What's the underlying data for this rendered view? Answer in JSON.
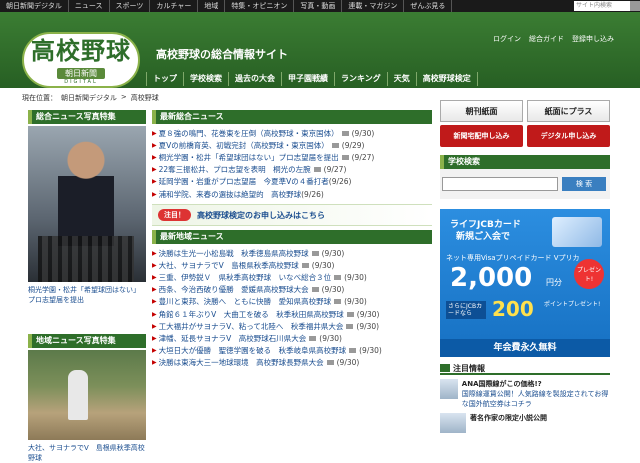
{
  "topbar": {
    "items": [
      "朝日新聞デジタル",
      "ニュース",
      "スポーツ",
      "カルチャー",
      "地域",
      "特集・オピニオン",
      "写真・動画",
      "連載・マガジン",
      "ぜんぶ見る"
    ],
    "search_placeholder": "サイト内検索"
  },
  "header": {
    "logo_main": "高校野球",
    "logo_sub": "朝日新聞",
    "logo_digital": "DIGITAL",
    "tagline": "高校野球の総合情報サイト",
    "util_links": [
      "ログイン",
      "総合ガイド",
      "登録申し込み"
    ],
    "nav": [
      "トップ",
      "学校検索",
      "過去の大会",
      "甲子園戦績",
      "ランキング",
      "天気",
      "高校野球検定"
    ]
  },
  "breadcrumb": [
    "現在位置：",
    "朝日新聞デジタル",
    ">",
    "高校野球"
  ],
  "left": {
    "photo_news_title": "総合ニュース写真特集",
    "photo_news_caption": "桐光学園・松井「希望球団はない」プロ志望届を提出",
    "local_news_title": "地域ニュース写真特集",
    "local_news_caption": "大社、サヨナラでV　島根県秋季高校野球"
  },
  "middle": {
    "general_title": "最新総合ニュース",
    "general_items": [
      {
        "t": "夏８強の鳴門、花巻東を圧倒（高校野球・東京国体）",
        "d": "(9/30)",
        "photo": true
      },
      {
        "t": "夏Vの前橋育英、初戦完封（高校野球・東京国体）",
        "d": "(9/29)",
        "photo": true
      },
      {
        "t": "桐光学園・松井「希望球団はない」プロ志望届を提出",
        "d": "(9/27)",
        "photo": true
      },
      {
        "t": "22奪三振松井、プロ志望を表明　桐光の左腕",
        "d": "(9/27)",
        "photo": true
      },
      {
        "t": "延岡学園・岩重がプロ志望届　今夏準Vの４番打者",
        "d": "(9/26)",
        "photo": false
      },
      {
        "t": "浦和学院、来春の選抜は絶望的　高校野球",
        "d": "(9/26)",
        "photo": false
      }
    ],
    "banner_badge": "注目！",
    "banner_text": "高校野球検定のお申し込みはこちら",
    "local_title": "最新地域ニュース",
    "local_items": [
      {
        "t": "決勝は生光一小松島戦　秋季徳島県高校野球",
        "d": "(9/30)",
        "photo": true
      },
      {
        "t": "大社、サヨナラでV　島根県秋季高校野球",
        "d": "(9/30)",
        "photo": true
      },
      {
        "t": "三重、伊勢鋭Ｖ　県秋季高校野球　いなべ総合３位",
        "d": "(9/30)",
        "photo": true
      },
      {
        "t": "西条、今治西破り優勝　愛媛県高校野球大会",
        "d": "(9/30)",
        "photo": true
      },
      {
        "t": "豊川と東邦、決勝へ　ともに快勝　愛知県高校野球",
        "d": "(9/30)",
        "photo": true
      },
      {
        "t": "角館６１年ぶりV　大曲工を破る　秋季秋田県高校野球",
        "d": "(9/30)",
        "photo": true
      },
      {
        "t": "工大福井がサヨナラV、粘って北陸へ　秋季福井県大会",
        "d": "(9/30)",
        "photo": true
      },
      {
        "t": "津幡、延長サヨナラV　高校野球石川県大会",
        "d": "(9/30)",
        "photo": true
      },
      {
        "t": "大垣日大が優勝　聖徳学園を破る　秋季岐阜県高校野球",
        "d": "(9/30)",
        "photo": true
      },
      {
        "t": "決勝は東海大三一地球環境　高校野球長野県大会",
        "d": "(9/30)",
        "photo": true
      }
    ]
  },
  "right": {
    "btn_asahi": "朝刊紙面",
    "btn_plus": "紙面にプラス",
    "btn_delivery": "新聞宅配申し込み",
    "btn_digital": "デジタル申し込み",
    "school_search_title": "学校検索",
    "search_button": "検 索",
    "ad": {
      "l1": "ライフJCBカード",
      "l2": "新規ご入会で",
      "l3": "ネット専用Visaプリペイドカード Vプリカ",
      "amount": "2,000",
      "unit": "円分",
      "present": "プレゼント!",
      "l4": "さらにJCBカードなら",
      "points": "200",
      "points_label": "ポイントプレゼント!",
      "foot": "年会費永久無料"
    },
    "notice_title": "注目情報",
    "notices": [
      {
        "t": "ANA国際線がこの価格!?",
        "s": "国際線運賃公開！人気路線を製設定されてお得な国外航空券はコチラ"
      },
      {
        "t": "著名作家の限定小説公開",
        "s": ""
      }
    ]
  }
}
